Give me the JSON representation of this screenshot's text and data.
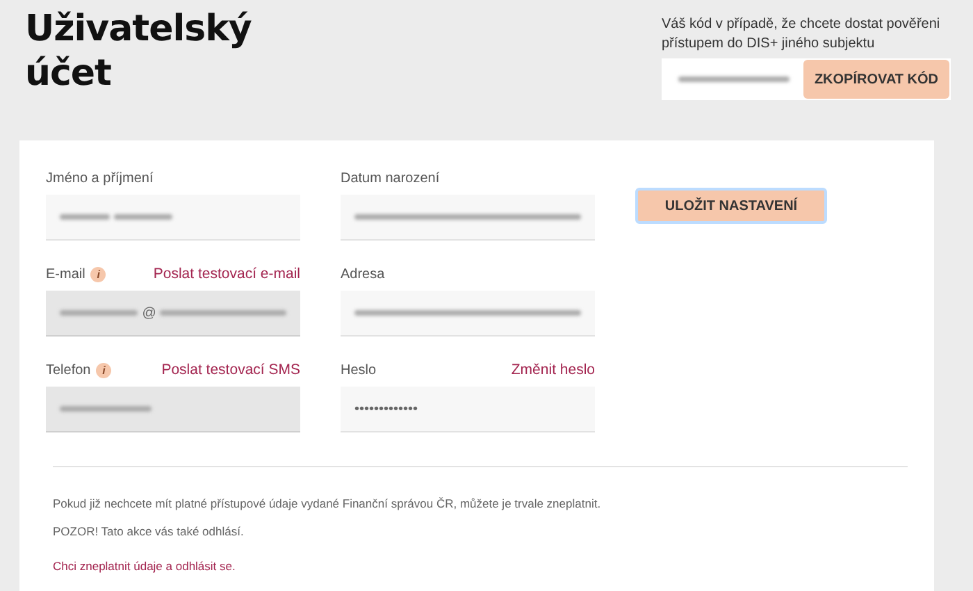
{
  "page": {
    "title": "Uživatelský účet"
  },
  "code_panel": {
    "hint": "Váš kód v případě, že chcete dostat pověřeni přístupem do DIS+ jiného subjektu",
    "code": [
      {
        "kind": "redacted"
      }
    ],
    "button": "ZKOPÍROVAT KÓD"
  },
  "fields": [
    {
      "label": "Jméno a příjmení",
      "readonly": false,
      "value": [
        {
          "kind": "redacted"
        },
        {
          "kind": "redacted"
        }
      ]
    },
    {
      "label": "Datum narození",
      "readonly": false,
      "value": [
        {
          "kind": "redacted"
        }
      ]
    },
    {
      "label": "E-mail",
      "info": "i",
      "action": "Poslat testovací e-mail",
      "readonly": true,
      "value": [
        {
          "kind": "redacted"
        },
        {
          "kind": "text",
          "text": "@"
        },
        {
          "kind": "redacted"
        }
      ]
    },
    {
      "label": "Adresa",
      "readonly": false,
      "value": [
        {
          "kind": "redacted"
        }
      ]
    },
    {
      "label": "Telefon",
      "info": "i",
      "action": "Poslat testovací SMS",
      "readonly": true,
      "value": [
        {
          "kind": "redacted"
        }
      ]
    },
    {
      "label": "Heslo",
      "action": "Změnit heslo",
      "readonly": false,
      "value": [
        {
          "kind": "text",
          "text": "•••••••••••••"
        }
      ]
    }
  ],
  "save_button": "ULOŽIT NASTAVENÍ",
  "notice": {
    "lines": [
      "Pokud již nechcete mít platné přístupové údaje vydané Finanční správou ČR, můžete je trvale zneplatnit.",
      "POZOR! Tato akce vás také odhlásí."
    ],
    "link": "Chci zneplatnit údaje a odhlásit se."
  }
}
